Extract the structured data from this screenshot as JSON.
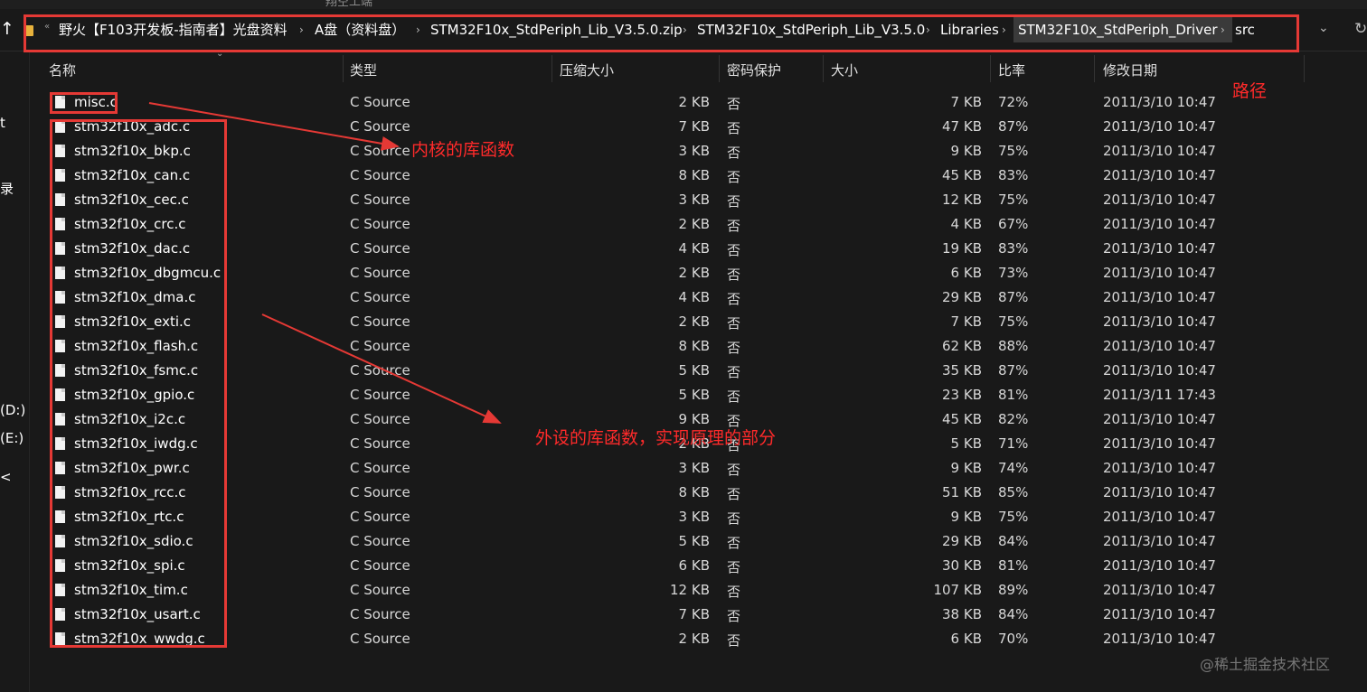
{
  "top_sliver_text": "翔空工端",
  "breadcrumb": [
    "野火【F103开发板-指南者】光盘资料",
    "A盘（资料盘）",
    "STM32F10x_StdPeriph_Lib_V3.5.0.zip",
    "STM32F10x_StdPeriph_Lib_V3.5.0",
    "Libraries",
    "STM32F10x_StdPeriph_Driver",
    "src"
  ],
  "nav": {
    "items": [
      "t",
      "录",
      "(D:)",
      "(E:)",
      "<"
    ]
  },
  "columns": [
    "名称",
    "类型",
    "压缩大小",
    "密码保护",
    "大小",
    "比率",
    "修改日期"
  ],
  "files": [
    {
      "name": "misc.c",
      "type": "C Source",
      "compressed": "2 KB",
      "password": "否",
      "size": "7 KB",
      "ratio": "72%",
      "modified": "2011/3/10 10:47"
    },
    {
      "name": "stm32f10x_adc.c",
      "type": "C Source",
      "compressed": "7 KB",
      "password": "否",
      "size": "47 KB",
      "ratio": "87%",
      "modified": "2011/3/10 10:47"
    },
    {
      "name": "stm32f10x_bkp.c",
      "type": "C Source",
      "compressed": "3 KB",
      "password": "否",
      "size": "9 KB",
      "ratio": "75%",
      "modified": "2011/3/10 10:47"
    },
    {
      "name": "stm32f10x_can.c",
      "type": "C Source",
      "compressed": "8 KB",
      "password": "否",
      "size": "45 KB",
      "ratio": "83%",
      "modified": "2011/3/10 10:47"
    },
    {
      "name": "stm32f10x_cec.c",
      "type": "C Source",
      "compressed": "3 KB",
      "password": "否",
      "size": "12 KB",
      "ratio": "75%",
      "modified": "2011/3/10 10:47"
    },
    {
      "name": "stm32f10x_crc.c",
      "type": "C Source",
      "compressed": "2 KB",
      "password": "否",
      "size": "4 KB",
      "ratio": "67%",
      "modified": "2011/3/10 10:47"
    },
    {
      "name": "stm32f10x_dac.c",
      "type": "C Source",
      "compressed": "4 KB",
      "password": "否",
      "size": "19 KB",
      "ratio": "83%",
      "modified": "2011/3/10 10:47"
    },
    {
      "name": "stm32f10x_dbgmcu.c",
      "type": "C Source",
      "compressed": "2 KB",
      "password": "否",
      "size": "6 KB",
      "ratio": "73%",
      "modified": "2011/3/10 10:47"
    },
    {
      "name": "stm32f10x_dma.c",
      "type": "C Source",
      "compressed": "4 KB",
      "password": "否",
      "size": "29 KB",
      "ratio": "87%",
      "modified": "2011/3/10 10:47"
    },
    {
      "name": "stm32f10x_exti.c",
      "type": "C Source",
      "compressed": "2 KB",
      "password": "否",
      "size": "7 KB",
      "ratio": "75%",
      "modified": "2011/3/10 10:47"
    },
    {
      "name": "stm32f10x_flash.c",
      "type": "C Source",
      "compressed": "8 KB",
      "password": "否",
      "size": "62 KB",
      "ratio": "88%",
      "modified": "2011/3/10 10:47"
    },
    {
      "name": "stm32f10x_fsmc.c",
      "type": "C Source",
      "compressed": "5 KB",
      "password": "否",
      "size": "35 KB",
      "ratio": "87%",
      "modified": "2011/3/10 10:47"
    },
    {
      "name": "stm32f10x_gpio.c",
      "type": "C Source",
      "compressed": "5 KB",
      "password": "否",
      "size": "23 KB",
      "ratio": "81%",
      "modified": "2011/3/11 17:43"
    },
    {
      "name": "stm32f10x_i2c.c",
      "type": "C Source",
      "compressed": "9 KB",
      "password": "否",
      "size": "45 KB",
      "ratio": "82%",
      "modified": "2011/3/10 10:47"
    },
    {
      "name": "stm32f10x_iwdg.c",
      "type": "C Source",
      "compressed": "2 KB",
      "password": "否",
      "size": "5 KB",
      "ratio": "71%",
      "modified": "2011/3/10 10:47"
    },
    {
      "name": "stm32f10x_pwr.c",
      "type": "C Source",
      "compressed": "3 KB",
      "password": "否",
      "size": "9 KB",
      "ratio": "74%",
      "modified": "2011/3/10 10:47"
    },
    {
      "name": "stm32f10x_rcc.c",
      "type": "C Source",
      "compressed": "8 KB",
      "password": "否",
      "size": "51 KB",
      "ratio": "85%",
      "modified": "2011/3/10 10:47"
    },
    {
      "name": "stm32f10x_rtc.c",
      "type": "C Source",
      "compressed": "3 KB",
      "password": "否",
      "size": "9 KB",
      "ratio": "75%",
      "modified": "2011/3/10 10:47"
    },
    {
      "name": "stm32f10x_sdio.c",
      "type": "C Source",
      "compressed": "5 KB",
      "password": "否",
      "size": "29 KB",
      "ratio": "84%",
      "modified": "2011/3/10 10:47"
    },
    {
      "name": "stm32f10x_spi.c",
      "type": "C Source",
      "compressed": "6 KB",
      "password": "否",
      "size": "30 KB",
      "ratio": "81%",
      "modified": "2011/3/10 10:47"
    },
    {
      "name": "stm32f10x_tim.c",
      "type": "C Source",
      "compressed": "12 KB",
      "password": "否",
      "size": "107 KB",
      "ratio": "89%",
      "modified": "2011/3/10 10:47"
    },
    {
      "name": "stm32f10x_usart.c",
      "type": "C Source",
      "compressed": "7 KB",
      "password": "否",
      "size": "38 KB",
      "ratio": "84%",
      "modified": "2011/3/10 10:47"
    },
    {
      "name": "stm32f10x_wwdg.c",
      "type": "C Source",
      "compressed": "2 KB",
      "password": "否",
      "size": "6 KB",
      "ratio": "70%",
      "modified": "2011/3/10 10:47"
    }
  ],
  "annotations": {
    "path_label": "路径",
    "core_label": "内核的库函数",
    "periph_label": "外设的库函数，实现原理的部分",
    "color": "#e53935"
  },
  "watermark": "@稀土掘金技术社区",
  "icons": [
    "up-arrow-icon",
    "folder-icon",
    "chevron-right-icon",
    "chevron-down-icon",
    "refresh-icon",
    "file-icon"
  ]
}
